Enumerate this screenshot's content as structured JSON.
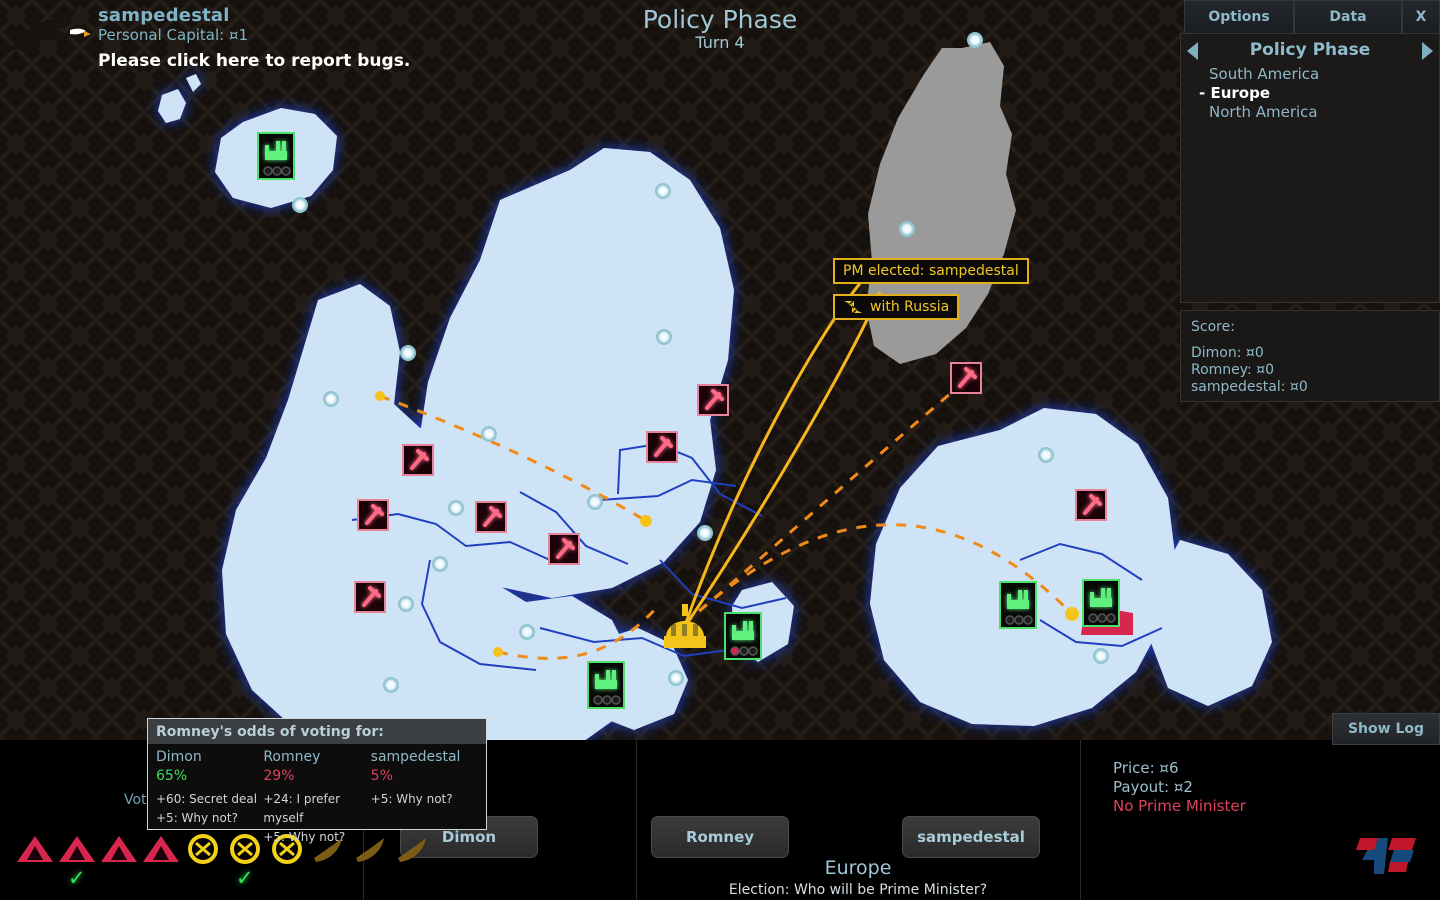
{
  "header": {
    "player_name": "sampedestal",
    "capital_line": "Personal Capital: ¤1",
    "bug_report": "Please click here to report bugs.",
    "eagle_icon": "eagle-icon"
  },
  "center": {
    "phase_title": "Policy Phase",
    "turn": "Turn 4"
  },
  "tabs": {
    "options": "Options",
    "data": "Data",
    "close": "X"
  },
  "policy_panel": {
    "title": "Policy Phase",
    "left_arrow": "chevron-left-icon",
    "right_arrow": "chevron-right-icon",
    "items": [
      {
        "label": "South America",
        "current": false
      },
      {
        "label": "- Europe",
        "current": true
      },
      {
        "label": "North America",
        "current": false
      }
    ]
  },
  "score_panel": {
    "heading": "Score:",
    "rows": [
      "Dimon: ¤0",
      "Romney: ¤0",
      "sampedestal: ¤0"
    ]
  },
  "map_tooltips": {
    "pm_elected": "PM elected: sampedestal",
    "with_russia": "with Russia",
    "with_russia_icon": "trade-arrows-icon"
  },
  "odds_tooltip": {
    "title": "Romney's odds of voting for:",
    "columns": [
      {
        "name": "Dimon",
        "percent": "65%",
        "percent_color": "#3fdc5a",
        "reasons": [
          "+60: Secret deal",
          "+5: Why not?"
        ]
      },
      {
        "name": "Romney",
        "percent": "29%",
        "percent_color": "#e0425c",
        "reasons": [
          "+24: I prefer myself",
          "+5: Why not?"
        ]
      },
      {
        "name": "sampedestal",
        "percent": "5%",
        "percent_color": "#e0425c",
        "reasons": [
          "+5: Why not?",
          ""
        ]
      }
    ]
  },
  "vote_label": "Vote",
  "election": {
    "region": "Europe",
    "question": "Election: Who will be Prime Minister?",
    "candidates": [
      "Dimon",
      "Romney",
      "sampedestal"
    ]
  },
  "right_info": {
    "price": "Price: ¤6",
    "payout": "Payout: ¤2",
    "status": "No Prime Minister"
  },
  "show_log": "Show Log",
  "logo": "4P",
  "colors": {
    "accent_blue": "#8fb8c8",
    "tooltip_yellow": "#f0c629",
    "danger_red": "#e0425c",
    "good_green": "#3fdc5a",
    "land": "#cfe3f7",
    "neutral_land": "#9a9a9a",
    "border_blue": "#2040c0"
  },
  "tray": {
    "influence": {
      "icon": "triangle-marker-icon",
      "count": 4,
      "checked_index": 1
    },
    "money": {
      "icon": "coin-icon",
      "count": 3,
      "checked_index": 1
    },
    "resource": {
      "icon": "banana-icon",
      "count": 3,
      "checked_index": -1
    }
  }
}
